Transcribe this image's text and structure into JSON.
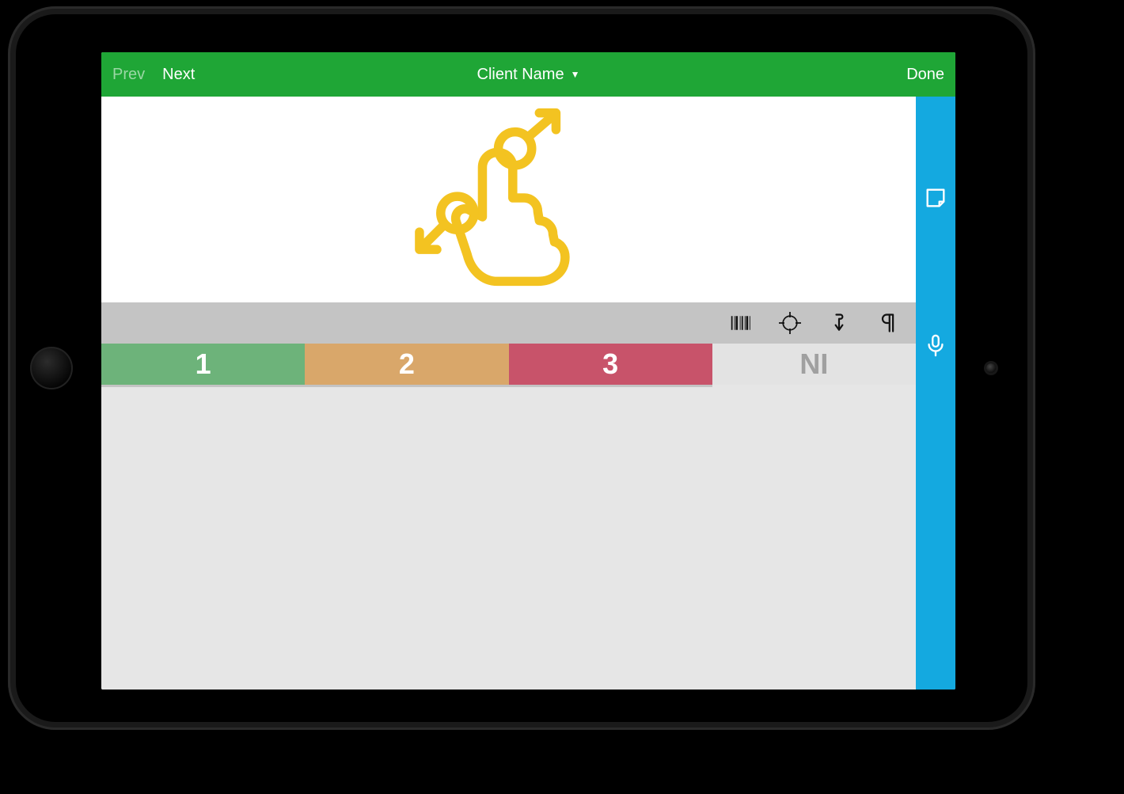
{
  "header": {
    "prev": "Prev",
    "next": "Next",
    "title": "Client Name",
    "done": "Done"
  },
  "toolbar_icons": {
    "barcode": "barcode-icon",
    "target": "target-icon",
    "insert": "insert-down-icon",
    "pilcrow": "pilcrow-icon"
  },
  "ratings": [
    {
      "label": "1",
      "class": "r1"
    },
    {
      "label": "2",
      "class": "r2"
    },
    {
      "label": "3",
      "class": "r3"
    },
    {
      "label": "NI",
      "class": "rNI"
    }
  ],
  "sidebar_icons": {
    "note": "sticky-note-icon",
    "mic": "microphone-icon"
  },
  "gesture_hint": "pinch-zoom-gesture-icon",
  "colors": {
    "header": "#1fa636",
    "sidebar": "#14a9e0",
    "rating1": "#6db37a",
    "rating2": "#d9a76a",
    "rating3": "#c8536a",
    "ratingNI": "#e3e3e3",
    "gesture": "#f3c321"
  }
}
